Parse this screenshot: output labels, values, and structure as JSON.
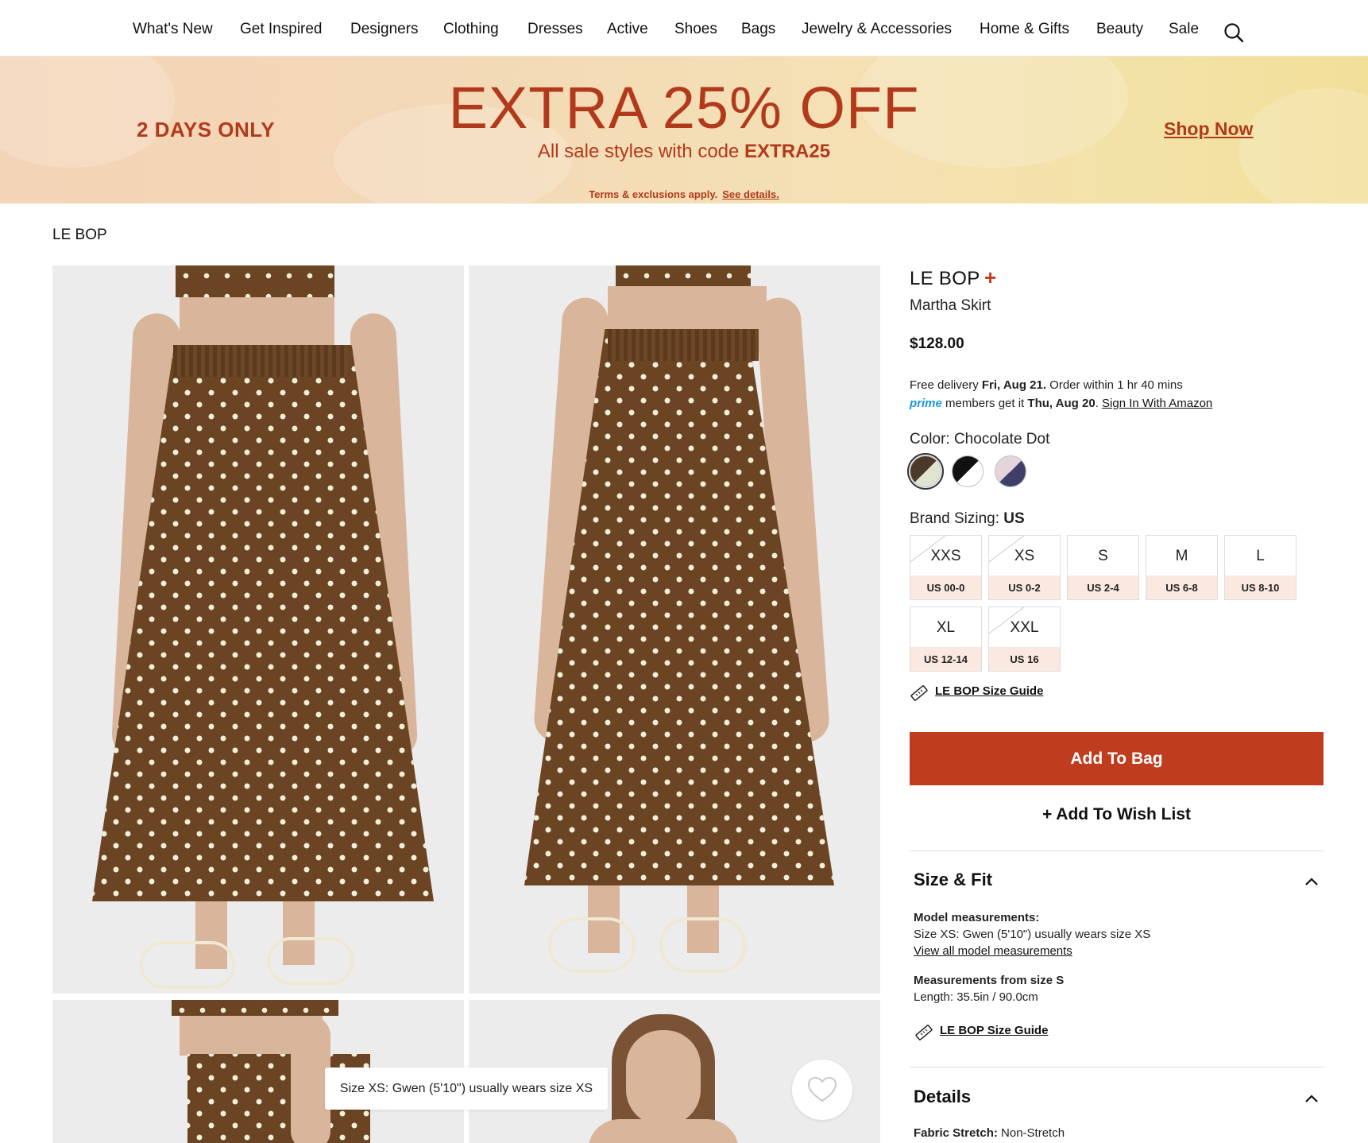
{
  "nav": {
    "items": [
      "What's New",
      "Get Inspired",
      "Designers",
      "Clothing",
      "Dresses",
      "Active",
      "Shoes",
      "Bags",
      "Jewelry & Accessories",
      "Home & Gifts",
      "Beauty",
      "Sale"
    ]
  },
  "banner": {
    "days": "2 DAYS ONLY",
    "headline": "EXTRA 25% OFF",
    "sub_prefix": "All sale styles with code ",
    "code": "EXTRA25",
    "terms": "Terms & exclusions apply.",
    "terms_link": "See details.",
    "shop_now": "Shop Now"
  },
  "breadcrumb": "LE BOP",
  "gallery": {
    "tooltip": "Size XS: Gwen (5'10\") usually wears size XS"
  },
  "product": {
    "brand": "LE BOP",
    "brand_plus": "+",
    "name": "Martha Skirt",
    "price": "$128.00",
    "delivery_line1_a": "Free delivery ",
    "delivery_line1_date": "Fri, Aug 21.",
    "delivery_line1_b": " Order within 1 hr 40 mins",
    "prime": "prime",
    "delivery_line2_a": " members get it ",
    "delivery_line2_date": "Thu, Aug 20",
    "delivery_line2_b": ". ",
    "amazon_link": "Sign In With Amazon",
    "color_label": "Color: Chocolate Dot",
    "swatches": [
      {
        "name": "Chocolate Dot",
        "c1": "#4b3a2a",
        "c2": "#dfe6cf",
        "selected": true
      },
      {
        "name": "Black White",
        "c1": "#111111",
        "c2": "#ffffff",
        "selected": false
      },
      {
        "name": "Lavender Navy",
        "c1": "#e4d4dc",
        "c2": "#3f3f6a",
        "selected": false
      }
    ],
    "sizing_label": "Brand Sizing: ",
    "sizing_value": "US",
    "sizes": [
      {
        "size": "XXS",
        "us": "US 00-0",
        "available": false
      },
      {
        "size": "XS",
        "us": "US 0-2",
        "available": false
      },
      {
        "size": "S",
        "us": "US 2-4",
        "available": true
      },
      {
        "size": "M",
        "us": "US 6-8",
        "available": true
      },
      {
        "size": "L",
        "us": "US 8-10",
        "available": true
      },
      {
        "size": "XL",
        "us": "US 12-14",
        "available": true
      },
      {
        "size": "XXL",
        "us": "US 16",
        "available": false
      }
    ],
    "size_guide": "LE BOP Size Guide",
    "add_to_bag": "Add To Bag",
    "wish_list": "+ Add To Wish List"
  },
  "size_fit": {
    "title": "Size & Fit",
    "model_label": "Model measurements:",
    "model_text": "Size XS: Gwen (5'10\") usually wears size XS",
    "model_link": "View all model measurements",
    "meas_label": "Measurements from size S",
    "meas_text": "Length: 35.5in / 90.0cm",
    "size_guide": "LE BOP Size Guide"
  },
  "details": {
    "title": "Details",
    "fabric_label": "Fabric Stretch:",
    "fabric_value": " Non-Stretch"
  },
  "colors": {
    "accent": "#bf3d1e",
    "banner_text": "#b23a1c"
  }
}
